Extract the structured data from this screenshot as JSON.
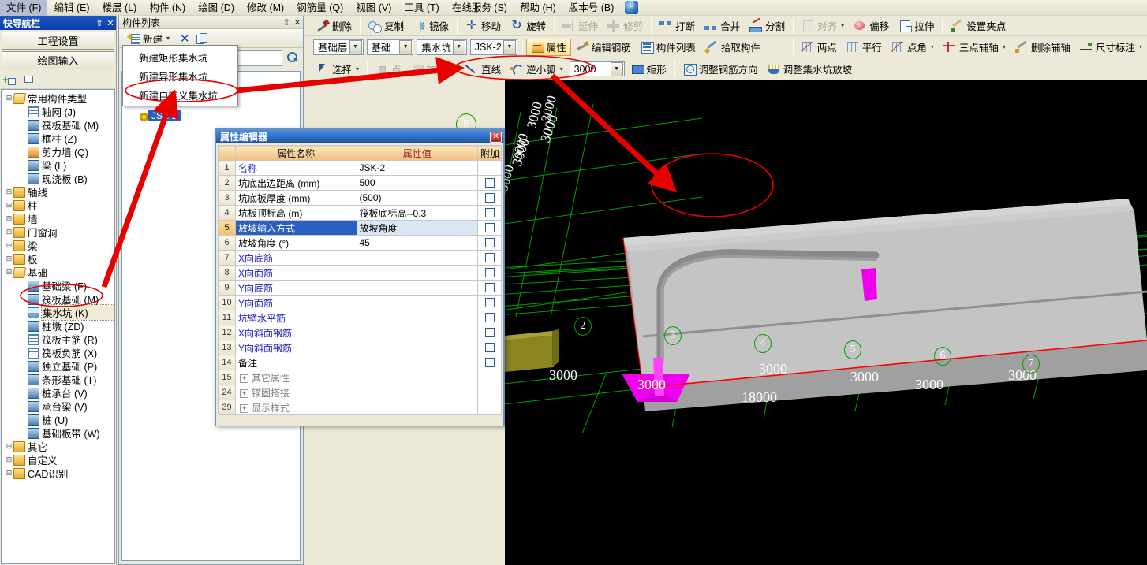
{
  "menubar": {
    "items": [
      {
        "label": "文件 (F)"
      },
      {
        "label": "编辑 (E)"
      },
      {
        "label": "楼层 (L)"
      },
      {
        "label": "构件 (N)"
      },
      {
        "label": "绘图 (D)"
      },
      {
        "label": "修改 (M)"
      },
      {
        "label": "钢筋量 (Q)"
      },
      {
        "label": "视图 (V)"
      },
      {
        "label": "工具 (T)"
      },
      {
        "label": "在线服务 (S)"
      },
      {
        "label": "帮助 (H)"
      },
      {
        "label": "版本号 (B)"
      }
    ],
    "logo_icon": "app-logo-icon"
  },
  "leftnav": {
    "title": "快导航栏",
    "pin_icon": "pin-icon",
    "close_icon": "close-icon",
    "buttons": [
      {
        "label": "工程设置"
      },
      {
        "label": "绘图输入"
      }
    ],
    "toolbar": {
      "expand_all_icon": "expand-all-icon",
      "collapse_all_icon": "collapse-all-icon"
    },
    "tree": [
      {
        "label": "常用构件类型",
        "level": 1,
        "icon": "folder-open-icon",
        "expanded": true
      },
      {
        "label": "轴网 (J)",
        "level": 2,
        "icon": "grid-icon"
      },
      {
        "label": "筏板基础 (M)",
        "level": 2,
        "icon": "raft-icon"
      },
      {
        "label": "框柱 (Z)",
        "level": 2,
        "icon": "column-icon"
      },
      {
        "label": "剪力墙 (Q)",
        "level": 2,
        "icon": "shearwall-icon"
      },
      {
        "label": "梁 (L)",
        "level": 2,
        "icon": "beam-icon"
      },
      {
        "label": "现浇板 (B)",
        "level": 2,
        "icon": "slab-icon"
      },
      {
        "label": "轴线",
        "level": 1,
        "icon": "folder-icon"
      },
      {
        "label": "柱",
        "level": 1,
        "icon": "folder-icon"
      },
      {
        "label": "墙",
        "level": 1,
        "icon": "folder-icon"
      },
      {
        "label": "门窗洞",
        "level": 1,
        "icon": "folder-icon"
      },
      {
        "label": "梁",
        "level": 1,
        "icon": "folder-icon"
      },
      {
        "label": "板",
        "level": 1,
        "icon": "folder-icon"
      },
      {
        "label": "基础",
        "level": 1,
        "icon": "folder-open-icon",
        "expanded": true
      },
      {
        "label": "基础梁 (F)",
        "level": 2,
        "icon": "foundation-beam-icon"
      },
      {
        "label": "筏板基础 (M)",
        "level": 2,
        "icon": "raft-icon"
      },
      {
        "label": "集水坑 (K)",
        "level": 2,
        "icon": "sump-pit-icon",
        "selected": true
      },
      {
        "label": "柱墩 (ZD)",
        "level": 2,
        "icon": "pier-icon"
      },
      {
        "label": "筏板主筋 (R)",
        "level": 2,
        "icon": "main-rebar-icon"
      },
      {
        "label": "筏板负筋 (X)",
        "level": 2,
        "icon": "neg-rebar-icon"
      },
      {
        "label": "独立基础 (P)",
        "level": 2,
        "icon": "isolated-foundation-icon"
      },
      {
        "label": "条形基础 (T)",
        "level": 2,
        "icon": "strip-foundation-icon"
      },
      {
        "label": "桩承台 (V)",
        "level": 2,
        "icon": "pile-cap-icon"
      },
      {
        "label": "承台梁 (V)",
        "level": 2,
        "icon": "cap-beam-icon"
      },
      {
        "label": "桩 (U)",
        "level": 2,
        "icon": "pile-icon"
      },
      {
        "label": "基础板带 (W)",
        "level": 2,
        "icon": "slab-band-icon"
      },
      {
        "label": "其它",
        "level": 1,
        "icon": "folder-icon"
      },
      {
        "label": "自定义",
        "level": 1,
        "icon": "folder-icon"
      },
      {
        "label": "CAD识别",
        "level": 1,
        "icon": "folder-icon"
      }
    ]
  },
  "complist": {
    "title": "构件列表",
    "pin_icon": "pin-icon",
    "close_icon": "close-icon",
    "toolbar": {
      "new_label": "新建",
      "new_icon": "new-document-icon",
      "new_caret": "▾",
      "delete_icon": "delete-x-icon",
      "copy_icon": "copy-icon"
    },
    "search": {
      "value": "",
      "placeholder": "",
      "icon": "search-icon"
    },
    "items": [
      {
        "label": "JSK-2",
        "icon": "component-icon",
        "selected": true
      }
    ]
  },
  "newmenu": {
    "items": [
      {
        "label": "新建矩形集水坑"
      },
      {
        "label": "新建异形集水坑"
      },
      {
        "label": "新建自定义集水坑",
        "highlighted": true
      }
    ]
  },
  "toolbar_row1": {
    "items": [
      {
        "label": "删除",
        "icon": "delete-icon",
        "enabled": true
      },
      {
        "label": "复制",
        "icon": "copy2-icon",
        "enabled": true
      },
      {
        "label": "镜像",
        "icon": "mirror-icon",
        "enabled": true
      },
      {
        "label": "移动",
        "icon": "move-icon",
        "enabled": true
      },
      {
        "label": "旋转",
        "icon": "rotate-icon",
        "enabled": true
      },
      {
        "label": "延伸",
        "icon": "extend-icon",
        "enabled": false
      },
      {
        "label": "修剪",
        "icon": "trim-icon",
        "enabled": false
      },
      {
        "label": "打断",
        "icon": "break-icon",
        "enabled": true
      },
      {
        "label": "合并",
        "icon": "merge-icon",
        "enabled": true
      },
      {
        "label": "分割",
        "icon": "split-icon",
        "enabled": true
      },
      {
        "label": "对齐",
        "icon": "align-icon",
        "enabled": false,
        "caret": "▾"
      },
      {
        "label": "偏移",
        "icon": "offset-icon",
        "enabled": true
      },
      {
        "label": "拉伸",
        "icon": "stretch-icon",
        "enabled": true
      },
      {
        "label": "设置夹点",
        "icon": "set-grip-icon",
        "enabled": true
      }
    ]
  },
  "toolbar_row2": {
    "combos": [
      {
        "name": "floor-select",
        "value": "基础层"
      },
      {
        "name": "category-select",
        "value": "基础"
      },
      {
        "name": "component-type-select",
        "value": "集水坑"
      },
      {
        "name": "component-select",
        "value": "JSK-2"
      }
    ],
    "buttons": [
      {
        "label": "属性",
        "icon": "property-icon",
        "active": true
      },
      {
        "label": "编辑钢筋",
        "icon": "edit-rebar-icon"
      },
      {
        "label": "构件列表",
        "icon": "component-list-icon"
      },
      {
        "label": "拾取构件",
        "icon": "pick-component-icon"
      }
    ],
    "axis_tools": [
      {
        "label": "两点",
        "icon": "two-point-icon"
      },
      {
        "label": "平行",
        "icon": "parallel-icon"
      },
      {
        "label": "点角",
        "icon": "point-angle-icon",
        "caret": "▾"
      },
      {
        "label": "三点辅轴",
        "icon": "three-point-axis-icon",
        "caret": "▾"
      },
      {
        "label": "删除辅轴",
        "icon": "delete-axis-icon"
      },
      {
        "label": "尺寸标注",
        "icon": "dimension-icon",
        "caret": "▾"
      }
    ]
  },
  "toolbar_row3": {
    "items": [
      {
        "label": "选择",
        "icon": "select-arrow-icon",
        "enabled": true,
        "caret": "▾"
      },
      {
        "label": "点",
        "icon": "point-icon",
        "enabled": false
      },
      {
        "label": "旋转点",
        "icon": "rotate-point-icon",
        "enabled": false
      },
      {
        "label": "直线",
        "icon": "line-icon",
        "enabled": true
      },
      {
        "label": "逆小弧",
        "icon": "ccw-arc-icon",
        "enabled": true,
        "caret": "▾"
      },
      {
        "label": "矩形",
        "icon": "rectangle-icon",
        "enabled": true
      },
      {
        "label": "调整钢筋方向",
        "icon": "adjust-rebar-dir-icon",
        "enabled": true
      },
      {
        "label": "调整集水坑放坡",
        "icon": "adjust-sump-slope-icon",
        "enabled": true
      }
    ],
    "arc_value": "3000"
  },
  "property_dialog": {
    "title": "属性编辑器",
    "close_icon": "close-icon",
    "headers": [
      "",
      "属性名称",
      "属性值",
      "附加"
    ],
    "rows": [
      {
        "n": "1",
        "name": "名称",
        "value": "JSK-2",
        "style": "blue",
        "checkbox": false,
        "selected": false
      },
      {
        "n": "2",
        "name": "坑底出边距离 (mm)",
        "value": "500",
        "style": "plain",
        "checkbox": true,
        "selected": false
      },
      {
        "n": "3",
        "name": "坑底板厚度 (mm)",
        "value": "(500)",
        "style": "plain",
        "checkbox": true,
        "selected": false
      },
      {
        "n": "4",
        "name": "坑板顶标高 (m)",
        "value": "筏板底标高--0.3",
        "style": "plain",
        "checkbox": true,
        "selected": false
      },
      {
        "n": "5",
        "name": "放坡输入方式",
        "value": "放坡角度",
        "style": "plain",
        "checkbox": true,
        "selected": true
      },
      {
        "n": "6",
        "name": "放坡角度 (°)",
        "value": "45",
        "style": "plain",
        "checkbox": true,
        "selected": false
      },
      {
        "n": "7",
        "name": "X向底筋",
        "value": "",
        "style": "blue",
        "checkbox": true,
        "selected": false
      },
      {
        "n": "8",
        "name": "X向面筋",
        "value": "",
        "style": "blue",
        "checkbox": true,
        "selected": false
      },
      {
        "n": "9",
        "name": "Y向底筋",
        "value": "",
        "style": "blue",
        "checkbox": true,
        "selected": false
      },
      {
        "n": "10",
        "name": "Y向面筋",
        "value": "",
        "style": "blue",
        "checkbox": true,
        "selected": false
      },
      {
        "n": "11",
        "name": "坑壁水平筋",
        "value": "",
        "style": "blue",
        "checkbox": true,
        "selected": false
      },
      {
        "n": "12",
        "name": "X向斜面钢筋",
        "value": "",
        "style": "blue",
        "checkbox": true,
        "selected": false
      },
      {
        "n": "13",
        "name": "Y向斜面钢筋",
        "value": "",
        "style": "blue",
        "checkbox": true,
        "selected": false
      },
      {
        "n": "14",
        "name": "备注",
        "value": "",
        "style": "plain",
        "checkbox": true,
        "selected": false
      },
      {
        "n": "15",
        "name": "其它属性",
        "value": "",
        "style": "group",
        "expander": "+",
        "checkbox": false,
        "selected": false
      },
      {
        "n": "24",
        "name": "锚固搭接",
        "value": "",
        "style": "group",
        "expander": "+",
        "checkbox": false,
        "selected": false
      },
      {
        "n": "39",
        "name": "显示样式",
        "value": "",
        "style": "group",
        "expander": "+",
        "checkbox": false,
        "selected": false
      }
    ]
  },
  "viewport": {
    "background_color": "#000000",
    "grid_line_color": "#00a000",
    "slab_color": "#bdbdbd",
    "pit_color": "#ff00ff",
    "highlight_color": "#ff0000",
    "axis_label": "E",
    "dim_labels_vertical": [
      "3000",
      "3000",
      "3000",
      "3000"
    ],
    "dim_labels_horizontal": [
      "3000",
      "3000",
      "3000",
      "3000",
      "3000",
      "3000"
    ],
    "total_dim_label": "18000",
    "grid_numbers": [
      "2",
      "3",
      "4",
      "5",
      "6",
      "7"
    ]
  },
  "annotations": {
    "ellipse_sump_pit_tree": "red-ellipse-highlight",
    "ellipse_new_custom_menu": "red-ellipse-highlight",
    "ellipse_line_arc_toolbar": "red-ellipse-highlight",
    "ellipse_model_curve": "red-ellipse-highlight",
    "arrow_to_menu": "red-arrow",
    "arrow_to_tree": "red-arrow",
    "arrow_to_model": "red-arrow"
  }
}
